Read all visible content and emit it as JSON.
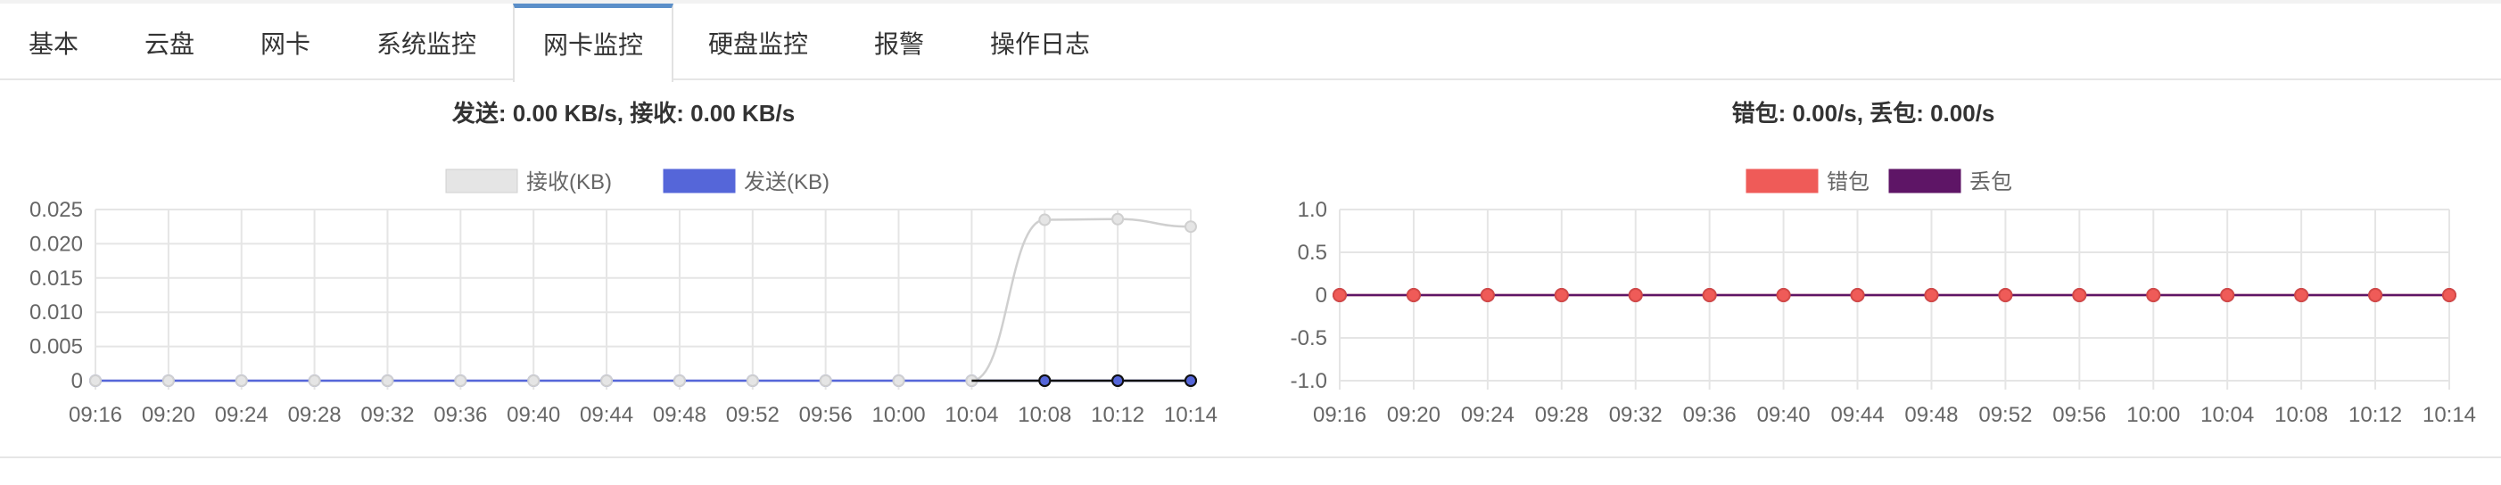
{
  "tabs": [
    {
      "label": "基本",
      "active": false
    },
    {
      "label": "云盘",
      "active": false
    },
    {
      "label": "网卡",
      "active": false
    },
    {
      "label": "系统监控",
      "active": false
    },
    {
      "label": "网卡监控",
      "active": true
    },
    {
      "label": "硬盘监控",
      "active": false
    },
    {
      "label": "报警",
      "active": false
    },
    {
      "label": "操作日志",
      "active": false
    }
  ],
  "chart_data": [
    {
      "type": "line",
      "title": "发送: 0.00 KB/s, 接收: 0.00 KB/s",
      "categories": [
        "09:16",
        "09:20",
        "09:24",
        "09:28",
        "09:32",
        "09:36",
        "09:40",
        "09:44",
        "09:48",
        "09:52",
        "09:56",
        "10:00",
        "10:04",
        "10:08",
        "10:12",
        "10:14"
      ],
      "series": [
        {
          "name": "接收(KB)",
          "color": "#e5e5e5",
          "values": [
            0,
            0,
            0,
            0,
            0,
            0,
            0,
            0,
            0,
            0,
            0,
            0,
            0,
            0.0235,
            0.0236,
            0.0225
          ]
        },
        {
          "name": "发送(KB)",
          "color": "#5566d9",
          "values": [
            0,
            0,
            0,
            0,
            0,
            0,
            0,
            0,
            0,
            0,
            0,
            0,
            0,
            0,
            0,
            0
          ]
        }
      ],
      "yticks": [
        "0.025",
        "0.020",
        "0.015",
        "0.010",
        "0.005",
        "0"
      ],
      "ylim": [
        0,
        0.025
      ],
      "grid": true,
      "legend": "top-center"
    },
    {
      "type": "line",
      "title": "错包: 0.00/s, 丢包: 0.00/s",
      "categories": [
        "09:16",
        "09:20",
        "09:24",
        "09:28",
        "09:32",
        "09:36",
        "09:40",
        "09:44",
        "09:48",
        "09:52",
        "09:56",
        "10:00",
        "10:04",
        "10:08",
        "10:12",
        "10:14"
      ],
      "series": [
        {
          "name": "错包",
          "color": "#ef5b58",
          "values": [
            0,
            0,
            0,
            0,
            0,
            0,
            0,
            0,
            0,
            0,
            0,
            0,
            0,
            0,
            0,
            0
          ]
        },
        {
          "name": "丢包",
          "color": "#5e1566",
          "values": [
            0,
            0,
            0,
            0,
            0,
            0,
            0,
            0,
            0,
            0,
            0,
            0,
            0,
            0,
            0,
            0
          ]
        }
      ],
      "yticks": [
        "1.0",
        "0.5",
        "0",
        "-0.5",
        "-1.0"
      ],
      "ylim": [
        -1,
        1
      ],
      "grid": true,
      "legend": "top-center"
    }
  ]
}
